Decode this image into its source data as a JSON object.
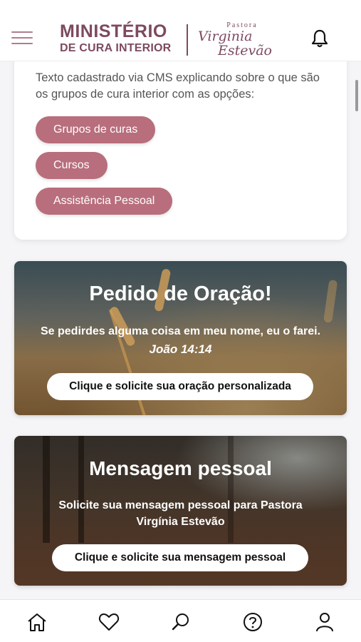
{
  "header": {
    "logo_line1": "MINISTÉRIO",
    "logo_line2": "DE CURA INTERIOR",
    "logo_pastora": "Pastora",
    "logo_name1": "Virginia",
    "logo_name2": "Estevão",
    "menu_icon": "hamburger-icon",
    "notification_icon": "bell-icon"
  },
  "intro": {
    "text": "Texto cadastrado via CMS explicando sobre o que são os grupos de cura interior com as opções:",
    "options": [
      "Grupos de curas",
      "Cursos",
      "Assistência Pessoal"
    ]
  },
  "prayer_banner": {
    "title": "Pedido de Oração!",
    "verse": "Se pedirdes alguma coisa em meu nome, eu o farei.",
    "reference": "João 14:14",
    "button": "Clique e solicite sua oração personalizada"
  },
  "message_banner": {
    "title": "Mensagem pessoal",
    "subtitle": "Solicite sua mensagem pessoal para Pastora Virgínia Estevão",
    "button": "Clique e solicite sua mensagem pessoal"
  },
  "bottom_nav": {
    "items": [
      "home-icon",
      "heart-icon",
      "search-icon",
      "help-icon",
      "user-icon"
    ]
  },
  "colors": {
    "brand": "#7d4a60",
    "pill": "#b86e7c",
    "menu_icon": "#b07e8d"
  }
}
